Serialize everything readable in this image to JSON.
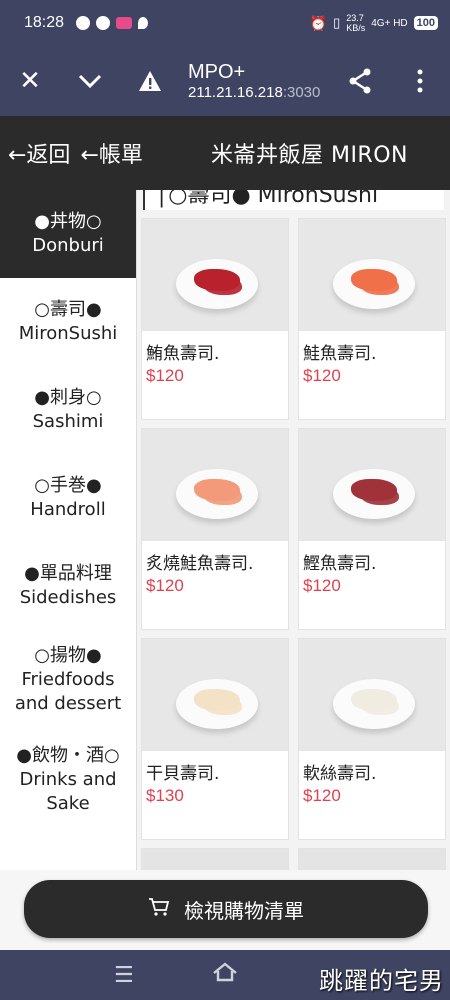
{
  "status_bar": {
    "time": "18:28",
    "net_speed_value": "23.7",
    "net_speed_unit": "KB/s",
    "network": "4G+ HD",
    "battery": "100"
  },
  "browser": {
    "title": "MPO+",
    "url_host": "211.21.16.218",
    "url_port": ":3030",
    "close_icon": "close-icon",
    "chevron_icon": "chevron-down-icon",
    "warning_icon": "warning-icon",
    "share_icon": "share-icon",
    "menu_icon": "more-vert-icon"
  },
  "header": {
    "back_label": "←返回",
    "bill_label": "←帳單",
    "brand": "米崙丼飯屋 MIRON"
  },
  "sidebar": {
    "items": [
      {
        "line1": "●丼物○",
        "line2": "Donburi",
        "active": true
      },
      {
        "line1": "○壽司●",
        "line2": "MironSushi",
        "active": false
      },
      {
        "line1": "●刺身○",
        "line2": "Sashimi",
        "active": false
      },
      {
        "line1": "○手巻●",
        "line2": "Handroll",
        "active": false
      },
      {
        "line1": "●單品料理",
        "line2": "Sidedishes",
        "active": false
      },
      {
        "line1": "○揚物●",
        "line2": "Friedfoods",
        "line3": "and dessert",
        "active": false
      },
      {
        "line1": "●飲物・酒○",
        "line2": "Drinks and",
        "line3": "Sake",
        "active": false
      }
    ]
  },
  "section": {
    "title": "│○壽司● MironSushi"
  },
  "products": [
    {
      "name": "鮪魚壽司.",
      "price": "$120",
      "color": "#b8222c"
    },
    {
      "name": "鮭魚壽司.",
      "price": "$120",
      "color": "#f0704a"
    },
    {
      "name": "炙燒鮭魚壽司.",
      "price": "$120",
      "color": "#f29a7a"
    },
    {
      "name": "鰹魚壽司.",
      "price": "$120",
      "color": "#a0323a"
    },
    {
      "name": "干貝壽司.",
      "price": "$130",
      "color": "#f3e2c6"
    },
    {
      "name": "軟絲壽司.",
      "price": "$120",
      "color": "#f1ece2"
    }
  ],
  "cart": {
    "label": "檢視購物清單",
    "icon": "cart-icon"
  },
  "watermark": "跳躍的宅男",
  "colors": {
    "system_bar": "#3f4463",
    "header_bg": "#2b2b2b",
    "price": "#e0414e"
  }
}
